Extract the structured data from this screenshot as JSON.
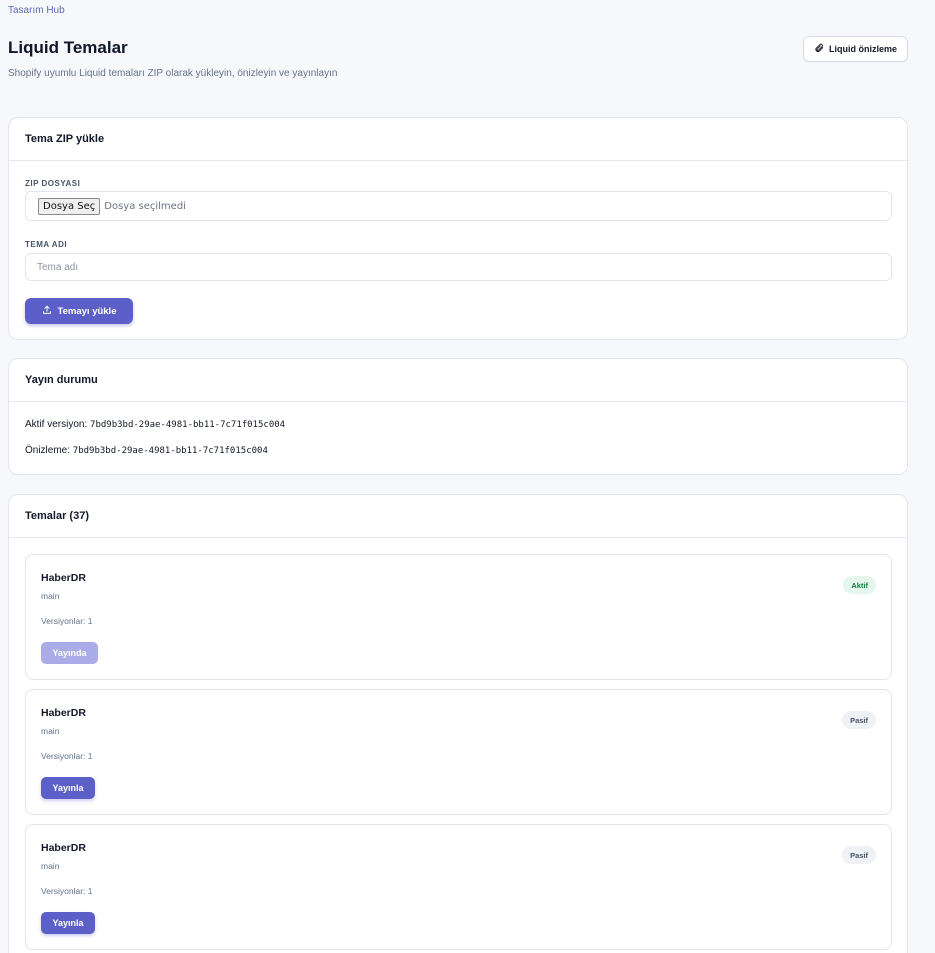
{
  "breadcrumb": "Tasarım Hub",
  "page": {
    "title": "Liquid Temalar",
    "subtitle": "Shopify uyumlu Liquid temaları ZIP olarak yükleyin, önizleyin ve yayınlayın",
    "preview_button": "Liquid önizleme"
  },
  "upload": {
    "title": "Tema ZIP yükle",
    "zip_label": "ZIP DOSYASI",
    "file_button": "Dosya Seç",
    "file_status": "Dosya seçilmedi",
    "name_label": "TEMA ADI",
    "name_placeholder": "Tema adı",
    "name_value": "",
    "submit_label": "Temayı yükle"
  },
  "publish": {
    "title": "Yayın durumu",
    "active_label": "Aktif versiyon:",
    "active_value": "7bd9b3bd-29ae-4981-bb11-7c71f015c004",
    "preview_label": "Önizleme:",
    "preview_value": "7bd9b3bd-29ae-4981-bb11-7c71f015c004"
  },
  "themes": {
    "title": "Temalar (37)",
    "items": [
      {
        "name": "HaberDR",
        "branch": "main",
        "versions": "Versiyonlar: 1",
        "status": "Aktif",
        "button": "Yayında"
      },
      {
        "name": "HaberDR",
        "branch": "main",
        "versions": "Versiyonlar: 1",
        "status": "Pasif",
        "button": "Yayınla"
      },
      {
        "name": "HaberDR",
        "branch": "main",
        "versions": "Versiyonlar: 1",
        "status": "Pasif",
        "button": "Yayınla"
      }
    ]
  },
  "colors": {
    "accent": "#5b5fc7",
    "accent_disabled": "#a9ace6",
    "active_badge_bg": "#e5f6ec",
    "active_badge_text": "#15803d",
    "passive_badge_bg": "#eef1f5"
  },
  "icons": {
    "preview_button": "paperclip-icon",
    "upload_button": "upload-icon"
  }
}
